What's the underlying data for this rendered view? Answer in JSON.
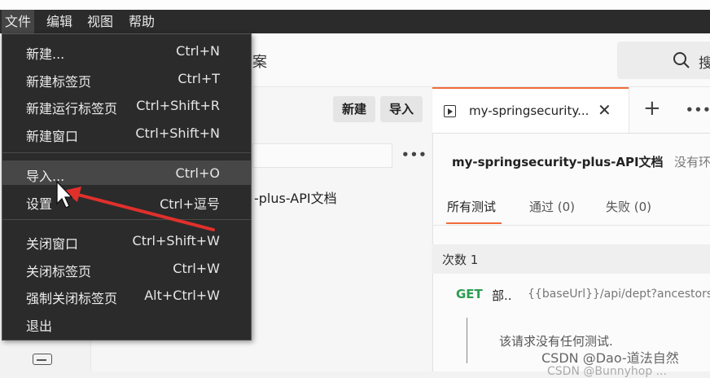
{
  "menubar": {
    "items": [
      {
        "label": "文件"
      },
      {
        "label": "编辑"
      },
      {
        "label": "视图"
      },
      {
        "label": "帮助"
      }
    ]
  },
  "file_menu": {
    "items": [
      {
        "label": "新建...",
        "shortcut": "Ctrl+N"
      },
      {
        "label": "新建标签页",
        "shortcut": "Ctrl+T"
      },
      {
        "label": "新建运行标签页",
        "shortcut": "Ctrl+Shift+R"
      },
      {
        "label": "新建窗口",
        "shortcut": "Ctrl+Shift+N"
      },
      {
        "label": "导入...",
        "shortcut": "Ctrl+O"
      },
      {
        "label": "设置",
        "shortcut": "Ctrl+逗号"
      },
      {
        "label": "关闭窗口",
        "shortcut": "Ctrl+Shift+W"
      },
      {
        "label": "关闭标签页",
        "shortcut": "Ctrl+W"
      },
      {
        "label": "强制关闭标签页",
        "shortcut": "Alt+Ctrl+W"
      },
      {
        "label": "退出",
        "shortcut": ""
      }
    ],
    "highlighted": "导入..."
  },
  "header": {
    "title_fragment": "案",
    "search_label": "搜"
  },
  "left_panel": {
    "new_button": "新建",
    "import_button": "导入",
    "more": "•••",
    "collection_name": "-plus-API文档"
  },
  "tab": {
    "title": "my-springsecurity...",
    "close": "✕",
    "plus": "+",
    "more": "•••"
  },
  "runner": {
    "title": "my-springsecurity-plus-API文档",
    "subtitle": "没有环",
    "tabs": [
      "所有测试",
      "通过 (0)",
      "失败 (0)"
    ],
    "iteration": "次数 1",
    "request": {
      "method": "GET",
      "name": "部..",
      "url": "{{baseUrl}}/api/dept?ancestors"
    },
    "no_tests_msg": "该请求没有任何测试."
  },
  "watermark": "CSDN @Dao-道法自然",
  "watermark2": "CSDN @Bunnyhop ..."
}
